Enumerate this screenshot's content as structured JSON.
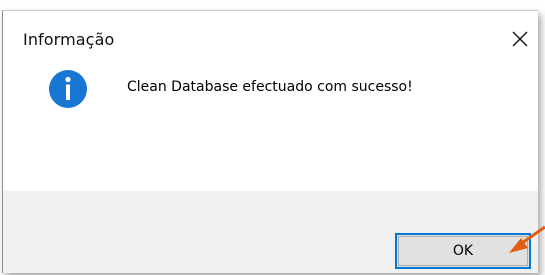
{
  "dialog": {
    "title": "Informação",
    "close_icon": "close-icon",
    "message": "Clean Database efectuado com sucesso!",
    "message_icon": "info-icon",
    "ok_label": "OK"
  },
  "colors": {
    "info_icon": "#1877d2",
    "ok_border": "#0078d7",
    "footer_bg": "#f0f0f0",
    "arrow": "#e35d10"
  }
}
